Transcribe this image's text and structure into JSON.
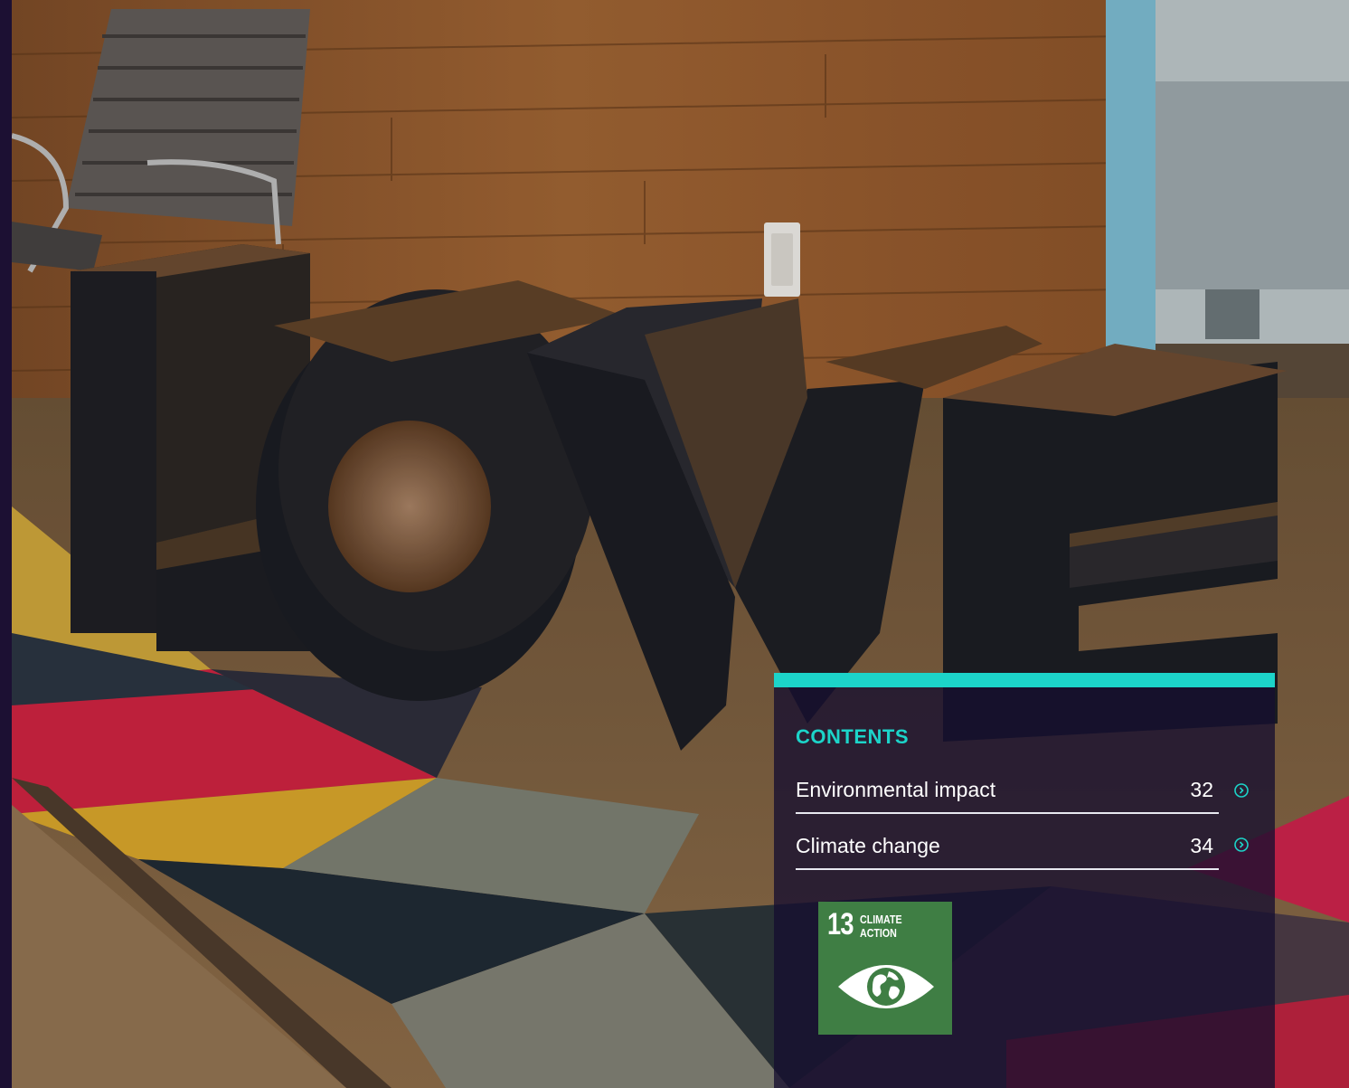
{
  "contents": {
    "heading": "CONTENTS",
    "items": [
      {
        "label": "Environmental impact",
        "page": "32"
      },
      {
        "label": "Climate change",
        "page": "34"
      }
    ]
  },
  "sdg_badge": {
    "number": "13",
    "title_line1": "CLIMATE",
    "title_line2": "ACTION"
  },
  "colors": {
    "accent": "#1cd4c9",
    "panel_bg": "#160e30",
    "sdg_green": "#3f7e44",
    "strip": "#1c1033"
  },
  "icons": {
    "row_arrow": "circle-chevron-right-icon",
    "sdg_symbol": "eye-globe-icon"
  }
}
